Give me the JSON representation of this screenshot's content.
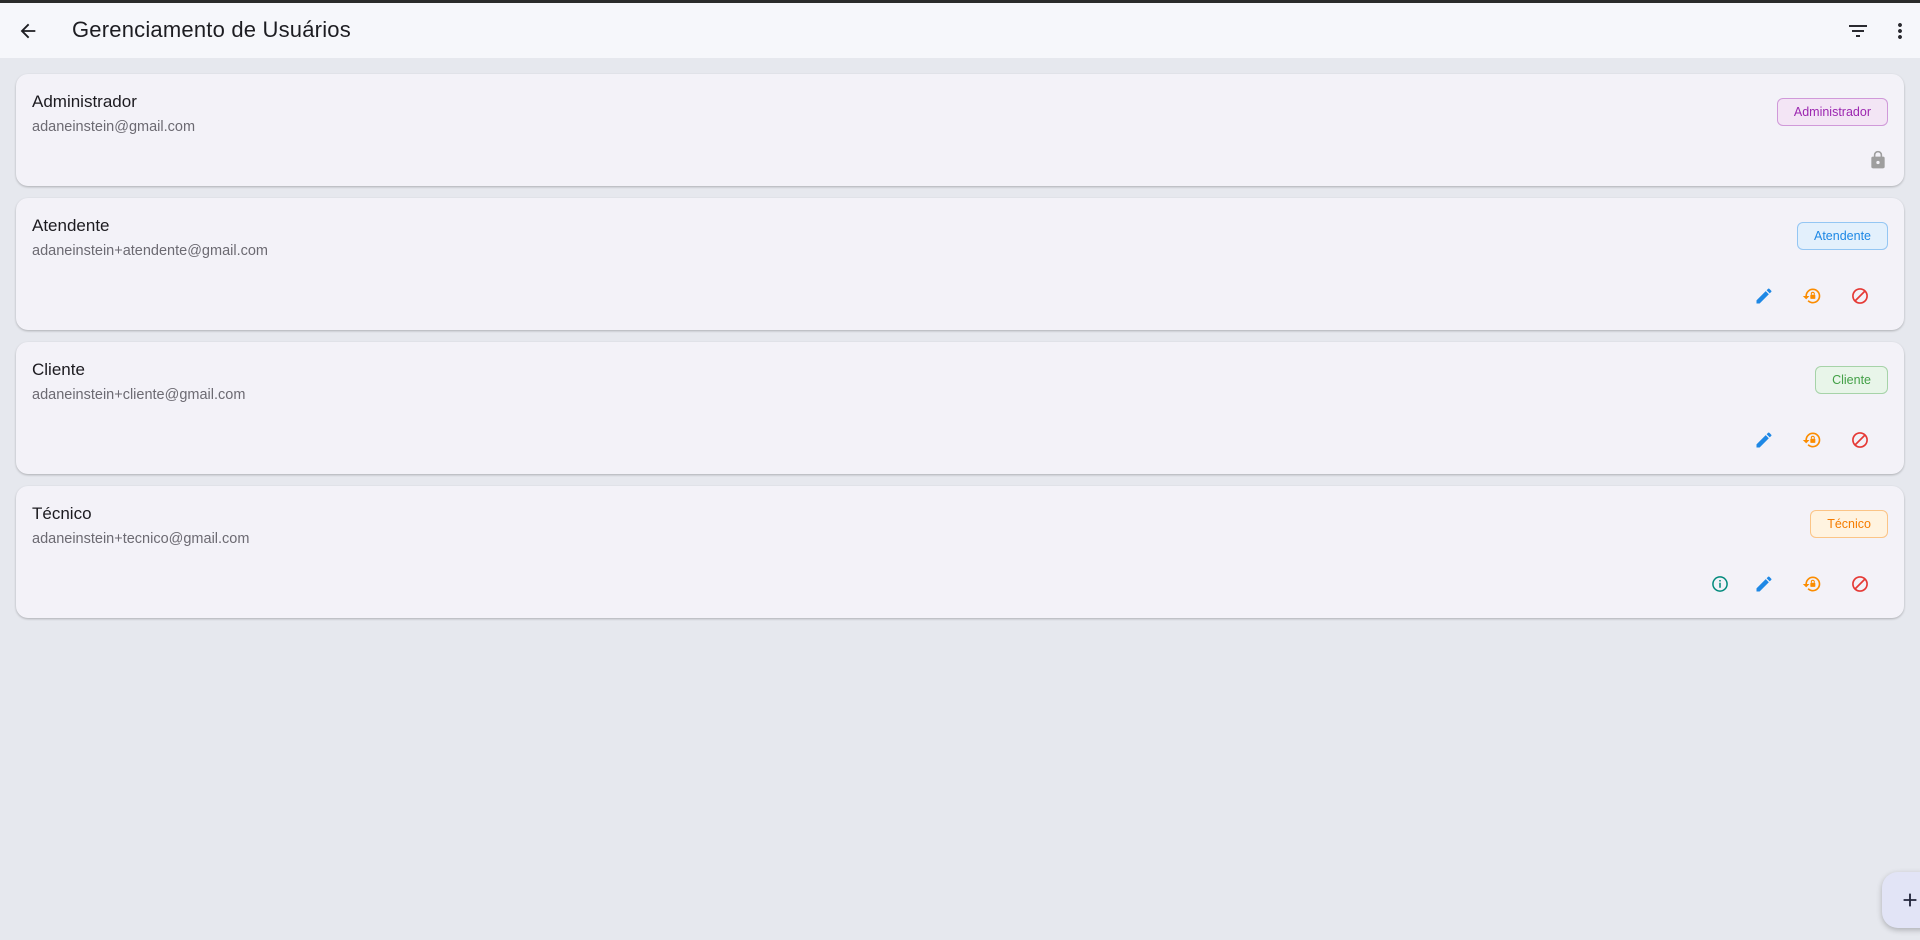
{
  "header": {
    "title": "Gerenciamento de Usuários",
    "back_icon": "arrow-back-icon",
    "filter_icon": "filter-icon",
    "more_icon": "more-vert-icon"
  },
  "users": [
    {
      "name": "Administrador",
      "email": "adaneinstein@gmail.com",
      "role": "Administrador",
      "role_color": "#9c27b0",
      "role_bg": "#f3e5f5",
      "locked": true,
      "actions": []
    },
    {
      "name": "Atendente",
      "email": "adaneinstein+atendente@gmail.com",
      "role": "Atendente",
      "role_color": "#1e88e5",
      "role_bg": "#e3f0fc",
      "locked": false,
      "actions": [
        "edit-icon",
        "reset-password-icon",
        "block-icon"
      ]
    },
    {
      "name": "Cliente",
      "email": "adaneinstein+cliente@gmail.com",
      "role": "Cliente",
      "role_color": "#43a047",
      "role_bg": "#e8f5e9",
      "locked": false,
      "actions": [
        "edit-icon",
        "reset-password-icon",
        "block-icon"
      ]
    },
    {
      "name": "Técnico",
      "email": "adaneinstein+tecnico@gmail.com",
      "role": "Técnico",
      "role_color": "#f57c00",
      "role_bg": "#fff3e0",
      "locked": false,
      "actions": [
        "info-icon",
        "edit-icon",
        "reset-password-icon",
        "block-icon"
      ]
    }
  ],
  "fab": {
    "icon": "add-icon"
  },
  "colors": {
    "edit": "#1e88e5",
    "reset": "#fb8c00",
    "block": "#e53935",
    "info": "#00897b",
    "lock": "#9e9e9e"
  }
}
